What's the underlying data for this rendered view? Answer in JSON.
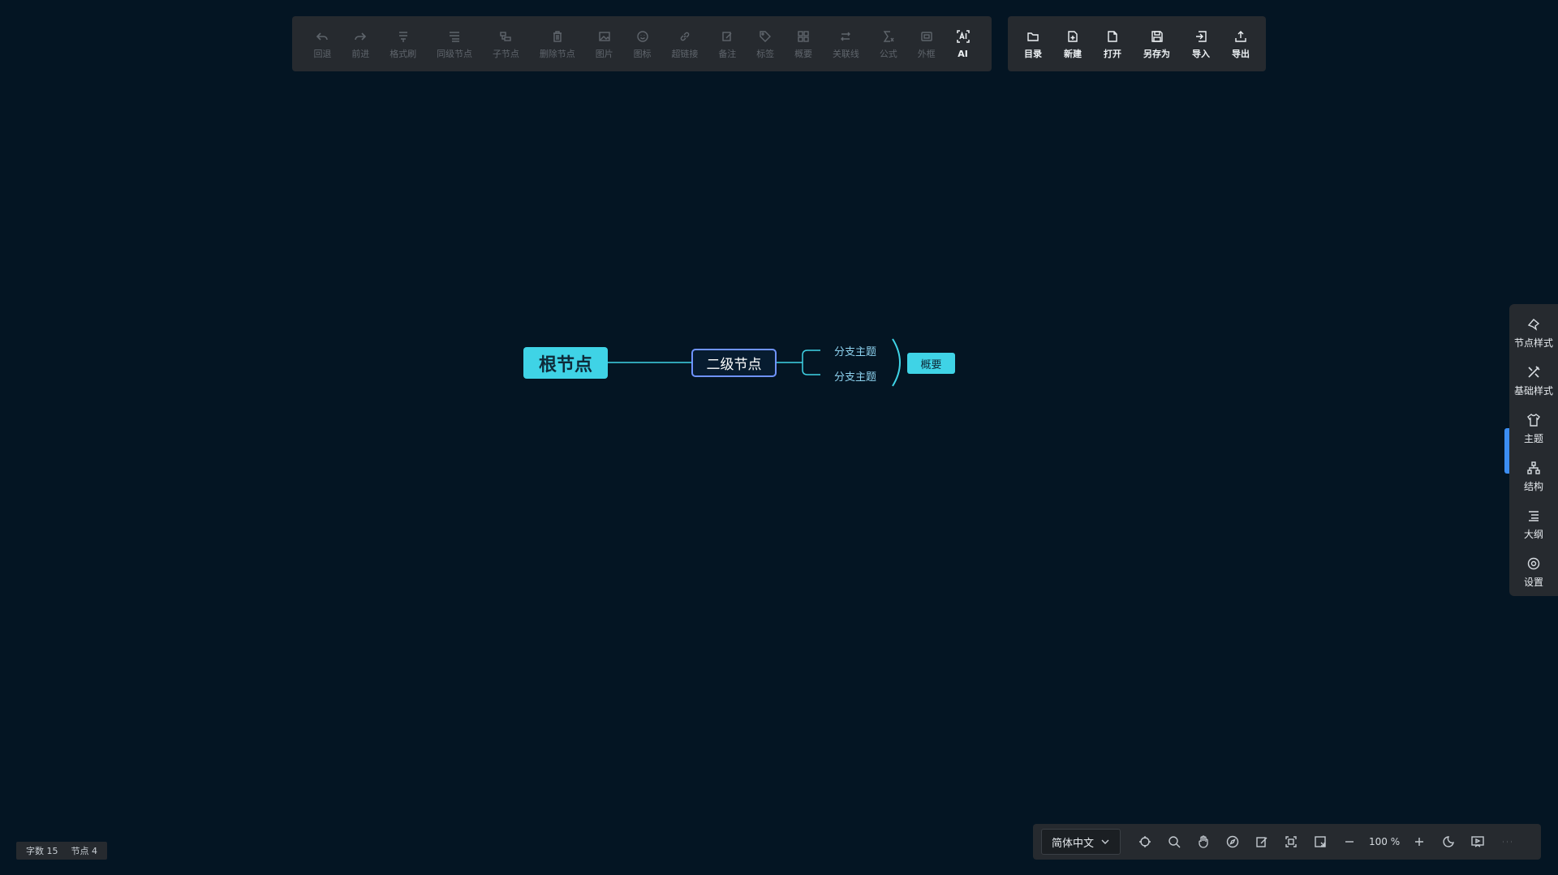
{
  "toolbar_left": [
    {
      "id": "undo",
      "label": "回退",
      "icon": "undo-icon",
      "enabled": false
    },
    {
      "id": "redo",
      "label": "前进",
      "icon": "redo-icon",
      "enabled": false
    },
    {
      "id": "format-painter",
      "label": "格式刷",
      "icon": "format-painter-icon",
      "enabled": false
    },
    {
      "id": "sibling-node",
      "label": "同级节点",
      "icon": "sibling-node-icon",
      "enabled": false
    },
    {
      "id": "child-node",
      "label": "子节点",
      "icon": "child-node-icon",
      "enabled": false
    },
    {
      "id": "delete-node",
      "label": "删除节点",
      "icon": "trash-icon",
      "enabled": false
    },
    {
      "id": "image",
      "label": "图片",
      "icon": "image-icon",
      "enabled": false
    },
    {
      "id": "icon",
      "label": "图标",
      "icon": "smiley-icon",
      "enabled": false
    },
    {
      "id": "hyperlink",
      "label": "超链接",
      "icon": "link-icon",
      "enabled": false
    },
    {
      "id": "note",
      "label": "备注",
      "icon": "note-icon",
      "enabled": false
    },
    {
      "id": "tag",
      "label": "标签",
      "icon": "tag-icon",
      "enabled": false
    },
    {
      "id": "summary",
      "label": "概要",
      "icon": "summary-icon",
      "enabled": false
    },
    {
      "id": "association",
      "label": "关联线",
      "icon": "association-line-icon",
      "enabled": false
    },
    {
      "id": "formula",
      "label": "公式",
      "icon": "formula-icon",
      "enabled": false
    },
    {
      "id": "frame",
      "label": "外框",
      "icon": "frame-icon",
      "enabled": false
    },
    {
      "id": "ai",
      "label": "AI",
      "icon": "ai-icon",
      "enabled": true
    }
  ],
  "toolbar_right": [
    {
      "id": "directory",
      "label": "目录",
      "icon": "folder-icon"
    },
    {
      "id": "new",
      "label": "新建",
      "icon": "new-file-icon"
    },
    {
      "id": "open",
      "label": "打开",
      "icon": "file-icon"
    },
    {
      "id": "save-as",
      "label": "另存为",
      "icon": "save-icon"
    },
    {
      "id": "import",
      "label": "导入",
      "icon": "import-icon"
    },
    {
      "id": "export",
      "label": "导出",
      "icon": "export-icon"
    }
  ],
  "mindmap": {
    "root": "根节点",
    "second": "二级节点",
    "branches": [
      "分支主题",
      "分支主题"
    ],
    "summary": "概要",
    "colors": {
      "root_bg": "#3fd3e6",
      "second_border": "#6f93ff",
      "line": "#3fd3e6",
      "branch_text": "#8ed3f0"
    }
  },
  "side_panel": [
    {
      "id": "node-style",
      "label": "节点样式",
      "icon": "node-style-icon"
    },
    {
      "id": "base-style",
      "label": "基础样式",
      "icon": "base-style-icon"
    },
    {
      "id": "theme",
      "label": "主题",
      "icon": "shirt-icon"
    },
    {
      "id": "structure",
      "label": "结构",
      "icon": "structure-icon"
    },
    {
      "id": "outline",
      "label": "大纲",
      "icon": "outline-icon"
    },
    {
      "id": "settings",
      "label": "设置",
      "icon": "gear-icon"
    }
  ],
  "stats": {
    "word_count": "字数 15",
    "node_count": "节点 4"
  },
  "bottom": {
    "language": "简体中文",
    "zoom": "100 %"
  },
  "theme": {
    "background": "#041523",
    "panel": "#262a2f",
    "accent": "#3b8df2"
  }
}
